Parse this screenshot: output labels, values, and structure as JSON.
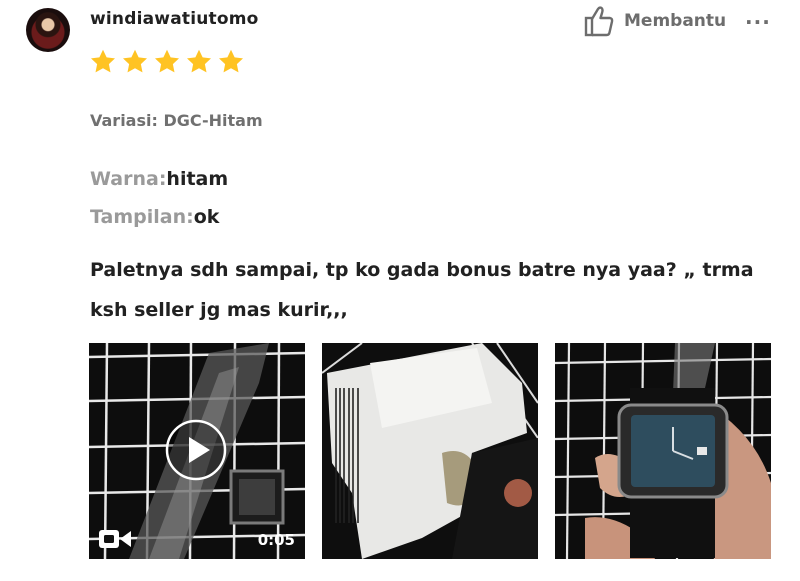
{
  "review": {
    "username": "windiawatiutomo",
    "rating": 5,
    "helpful_label": "Membantu",
    "more_label": "···",
    "variation": "Variasi: DGC-Hitam",
    "attributes": [
      {
        "key": "Warna:",
        "value": "hitam"
      },
      {
        "key": "Tampilan:",
        "value": "ok"
      }
    ],
    "comment": "Paletnya sdh sampai, tp ko gada bonus batre nya yaa? „ trma ksh seller jg mas kurir,,,",
    "media": [
      {
        "type": "video",
        "duration": "0:05"
      },
      {
        "type": "image"
      },
      {
        "type": "image"
      }
    ]
  },
  "colors": {
    "star": "#ffc323",
    "muted": "#9a9a9a",
    "text": "#212121"
  }
}
